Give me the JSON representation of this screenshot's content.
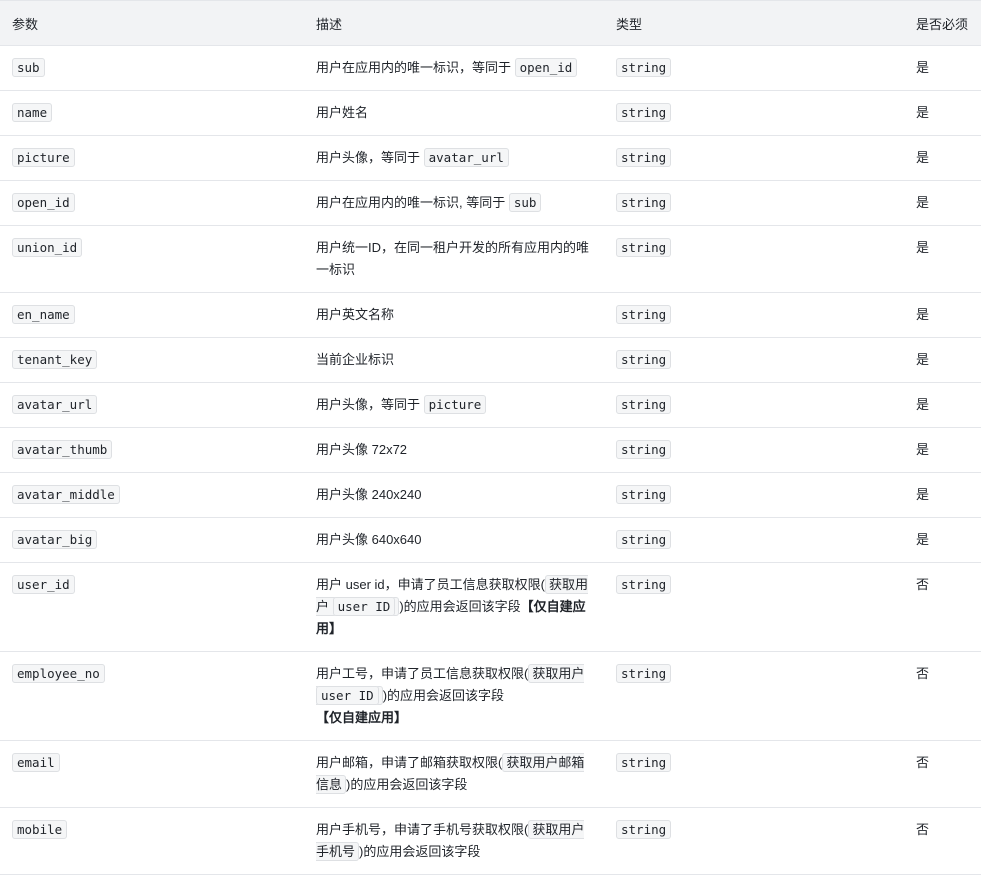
{
  "headers": {
    "param": "参数",
    "desc": "描述",
    "type": "类型",
    "required": "是否必须"
  },
  "rows": [
    {
      "param": "sub",
      "desc_pre": "用户在应用内的唯一标识，等同于 ",
      "desc_code": "open_id",
      "desc_post": "",
      "type": "string",
      "required": "是"
    },
    {
      "param": "name",
      "desc": "用户姓名",
      "type": "string",
      "required": "是"
    },
    {
      "param": "picture",
      "desc_pre": "用户头像，等同于 ",
      "desc_code": "avatar_url",
      "desc_post": "",
      "type": "string",
      "required": "是"
    },
    {
      "param": "open_id",
      "desc_pre": "用户在应用内的唯一标识, 等同于 ",
      "desc_code": "sub",
      "desc_post": "",
      "type": "string",
      "required": "是"
    },
    {
      "param": "union_id",
      "desc": "用户统一ID，在同一租户开发的所有应用内的唯一标识",
      "type": "string",
      "required": "是"
    },
    {
      "param": "en_name",
      "desc": "用户英文名称",
      "type": "string",
      "required": "是"
    },
    {
      "param": "tenant_key",
      "desc": "当前企业标识",
      "type": "string",
      "required": "是"
    },
    {
      "param": "avatar_url",
      "desc_pre": "用户头像，等同于 ",
      "desc_code": "picture",
      "desc_post": "",
      "type": "string",
      "required": "是"
    },
    {
      "param": "avatar_thumb",
      "desc": "用户头像 72x72",
      "type": "string",
      "required": "是"
    },
    {
      "param": "avatar_middle",
      "desc": "用户头像 240x240",
      "type": "string",
      "required": "是"
    },
    {
      "param": "avatar_big",
      "desc": "用户头像 640x640",
      "type": "string",
      "required": "是"
    },
    {
      "param": "user_id",
      "desc_pre": "用户 user id，申请了员工信息获取权限(",
      "desc_link_pre": "获取用户 ",
      "desc_link_code": "user ID",
      "desc_mid": ")的应用会返回该字段",
      "desc_bold": "【仅自建应用】",
      "type": "string",
      "required": "否"
    },
    {
      "param": "employee_no",
      "desc_pre": "用户工号，申请了员工信息获取权限(",
      "desc_link_pre": "获取用户 ",
      "desc_link_code": "user ID",
      "desc_mid": ")的应用会返回该字段",
      "desc_bold": "【仅自建应用】",
      "type": "string",
      "required": "否"
    },
    {
      "param": "email",
      "desc_pre": "用户邮箱，申请了邮箱获取权限(",
      "desc_link": "获取用户邮箱信息",
      "desc_mid": ")的应用会返回该字段",
      "type": "string",
      "required": "否"
    },
    {
      "param": "mobile",
      "desc_pre": "用户手机号，申请了手机号获取权限(",
      "desc_link": "获取用户手机号",
      "desc_mid": ")的应用会返回该字段",
      "type": "string",
      "required": "否"
    }
  ]
}
